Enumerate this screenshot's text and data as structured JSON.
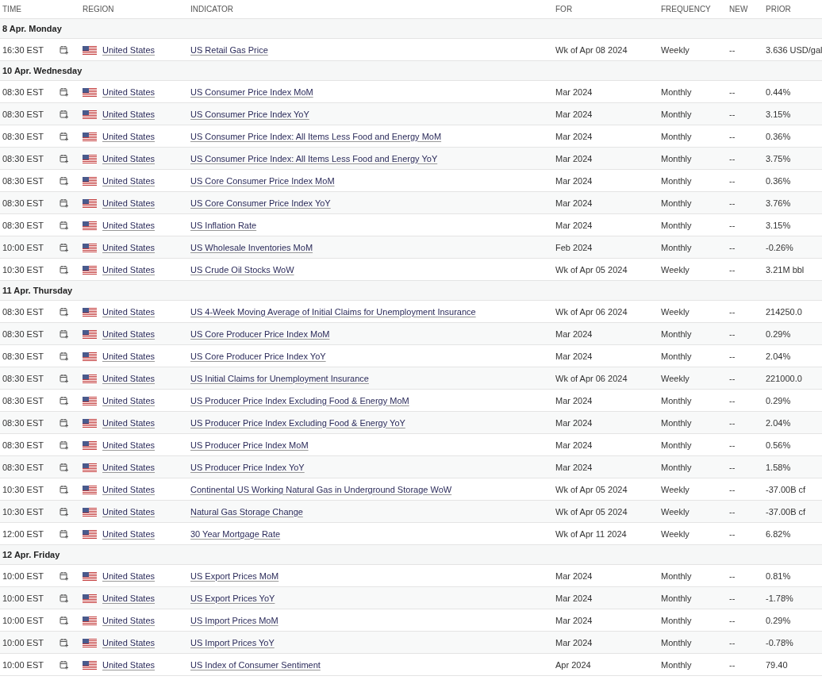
{
  "columns": [
    "TIME",
    "REGION",
    "INDICATOR",
    "FOR",
    "FREQUENCY",
    "NEW",
    "PRIOR"
  ],
  "days": [
    {
      "date": "8 Apr. Monday",
      "events": [
        {
          "time": "16:30 EST",
          "region": "United States",
          "indicator": "US Retail Gas Price",
          "for": "Wk of Apr 08 2024",
          "frequency": "Weekly",
          "new": "--",
          "prior": "3.636 USD/gal"
        }
      ]
    },
    {
      "date": "10 Apr. Wednesday",
      "events": [
        {
          "time": "08:30 EST",
          "region": "United States",
          "indicator": "US Consumer Price Index MoM",
          "for": "Mar 2024",
          "frequency": "Monthly",
          "new": "--",
          "prior": "0.44%"
        },
        {
          "time": "08:30 EST",
          "region": "United States",
          "indicator": "US Consumer Price Index YoY",
          "for": "Mar 2024",
          "frequency": "Monthly",
          "new": "--",
          "prior": "3.15%"
        },
        {
          "time": "08:30 EST",
          "region": "United States",
          "indicator": "US Consumer Price Index: All Items Less Food and Energy MoM",
          "for": "Mar 2024",
          "frequency": "Monthly",
          "new": "--",
          "prior": "0.36%"
        },
        {
          "time": "08:30 EST",
          "region": "United States",
          "indicator": "US Consumer Price Index: All Items Less Food and Energy YoY",
          "for": "Mar 2024",
          "frequency": "Monthly",
          "new": "--",
          "prior": "3.75%"
        },
        {
          "time": "08:30 EST",
          "region": "United States",
          "indicator": "US Core Consumer Price Index MoM",
          "for": "Mar 2024",
          "frequency": "Monthly",
          "new": "--",
          "prior": "0.36%"
        },
        {
          "time": "08:30 EST",
          "region": "United States",
          "indicator": "US Core Consumer Price Index YoY",
          "for": "Mar 2024",
          "frequency": "Monthly",
          "new": "--",
          "prior": "3.76%"
        },
        {
          "time": "08:30 EST",
          "region": "United States",
          "indicator": "US Inflation Rate",
          "for": "Mar 2024",
          "frequency": "Monthly",
          "new": "--",
          "prior": "3.15%"
        },
        {
          "time": "10:00 EST",
          "region": "United States",
          "indicator": "US Wholesale Inventories MoM",
          "for": "Feb 2024",
          "frequency": "Monthly",
          "new": "--",
          "prior": "-0.26%"
        },
        {
          "time": "10:30 EST",
          "region": "United States",
          "indicator": "US Crude Oil Stocks WoW",
          "for": "Wk of Apr 05 2024",
          "frequency": "Weekly",
          "new": "--",
          "prior": "3.21M bbl"
        }
      ]
    },
    {
      "date": "11 Apr. Thursday",
      "events": [
        {
          "time": "08:30 EST",
          "region": "United States",
          "indicator": "US 4-Week Moving Average of Initial Claims for Unemployment Insurance",
          "for": "Wk of Apr 06 2024",
          "frequency": "Weekly",
          "new": "--",
          "prior": "214250.0"
        },
        {
          "time": "08:30 EST",
          "region": "United States",
          "indicator": "US Core Producer Price Index MoM",
          "for": "Mar 2024",
          "frequency": "Monthly",
          "new": "--",
          "prior": "0.29%"
        },
        {
          "time": "08:30 EST",
          "region": "United States",
          "indicator": "US Core Producer Price Index YoY",
          "for": "Mar 2024",
          "frequency": "Monthly",
          "new": "--",
          "prior": "2.04%"
        },
        {
          "time": "08:30 EST",
          "region": "United States",
          "indicator": "US Initial Claims for Unemployment Insurance",
          "for": "Wk of Apr 06 2024",
          "frequency": "Weekly",
          "new": "--",
          "prior": "221000.0"
        },
        {
          "time": "08:30 EST",
          "region": "United States",
          "indicator": "US Producer Price Index Excluding Food & Energy MoM",
          "for": "Mar 2024",
          "frequency": "Monthly",
          "new": "--",
          "prior": "0.29%"
        },
        {
          "time": "08:30 EST",
          "region": "United States",
          "indicator": "US Producer Price Index Excluding Food & Energy YoY",
          "for": "Mar 2024",
          "frequency": "Monthly",
          "new": "--",
          "prior": "2.04%"
        },
        {
          "time": "08:30 EST",
          "region": "United States",
          "indicator": "US Producer Price Index MoM",
          "for": "Mar 2024",
          "frequency": "Monthly",
          "new": "--",
          "prior": "0.56%"
        },
        {
          "time": "08:30 EST",
          "region": "United States",
          "indicator": "US Producer Price Index YoY",
          "for": "Mar 2024",
          "frequency": "Monthly",
          "new": "--",
          "prior": "1.58%"
        },
        {
          "time": "10:30 EST",
          "region": "United States",
          "indicator": "Continental US Working Natural Gas in Underground Storage WoW",
          "for": "Wk of Apr 05 2024",
          "frequency": "Weekly",
          "new": "--",
          "prior": "-37.00B cf"
        },
        {
          "time": "10:30 EST",
          "region": "United States",
          "indicator": "Natural Gas Storage Change",
          "for": "Wk of Apr 05 2024",
          "frequency": "Weekly",
          "new": "--",
          "prior": "-37.00B cf"
        },
        {
          "time": "12:00 EST",
          "region": "United States",
          "indicator": "30 Year Mortgage Rate",
          "for": "Wk of Apr 11 2024",
          "frequency": "Weekly",
          "new": "--",
          "prior": "6.82%"
        }
      ]
    },
    {
      "date": "12 Apr. Friday",
      "events": [
        {
          "time": "10:00 EST",
          "region": "United States",
          "indicator": "US Export Prices MoM",
          "for": "Mar 2024",
          "frequency": "Monthly",
          "new": "--",
          "prior": "0.81%"
        },
        {
          "time": "10:00 EST",
          "region": "United States",
          "indicator": "US Export Prices YoY",
          "for": "Mar 2024",
          "frequency": "Monthly",
          "new": "--",
          "prior": "-1.78%"
        },
        {
          "time": "10:00 EST",
          "region": "United States",
          "indicator": "US Import Prices MoM",
          "for": "Mar 2024",
          "frequency": "Monthly",
          "new": "--",
          "prior": "0.29%"
        },
        {
          "time": "10:00 EST",
          "region": "United States",
          "indicator": "US Import Prices YoY",
          "for": "Mar 2024",
          "frequency": "Monthly",
          "new": "--",
          "prior": "-0.78%"
        },
        {
          "time": "10:00 EST",
          "region": "United States",
          "indicator": "US Index of Consumer Sentiment",
          "for": "Apr 2024",
          "frequency": "Monthly",
          "new": "--",
          "prior": "79.40"
        }
      ]
    }
  ]
}
